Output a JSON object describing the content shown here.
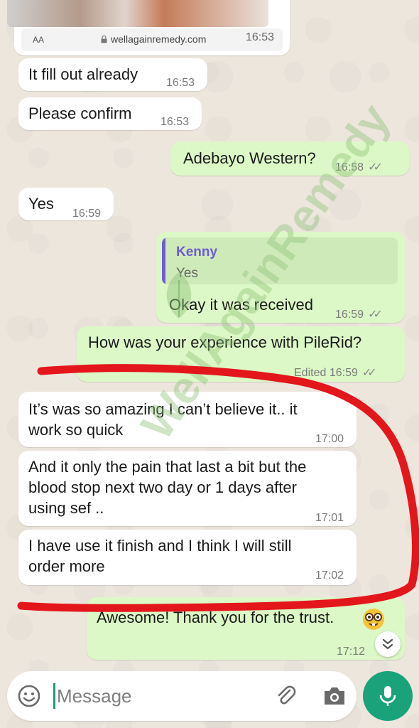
{
  "link_preview": {
    "aa_label": "AA",
    "url": "wellagainremedy.com",
    "time": "16:53"
  },
  "messages": [
    {
      "direction": "incoming",
      "text": "It fill out already",
      "time": "16:53"
    },
    {
      "direction": "incoming",
      "text": "Please confirm",
      "time": "16:53"
    },
    {
      "direction": "outgoing",
      "text": "Adebayo Western?",
      "time": "16:58",
      "status": "read"
    },
    {
      "direction": "incoming",
      "text": "Yes",
      "time": "16:59"
    },
    {
      "direction": "outgoing",
      "reply_to": {
        "name": "Kenny",
        "text": "Yes"
      },
      "text": "Okay it was received",
      "time": "16:59",
      "status": "read"
    },
    {
      "direction": "outgoing",
      "text": "How was your experience with PileRid?",
      "edited_label": "Edited",
      "time": "16:59",
      "status": "read"
    },
    {
      "direction": "incoming",
      "lines": [
        "It’s was so amazing I can’t believe it.. it",
        "work so quick"
      ],
      "time": "17:00"
    },
    {
      "direction": "incoming",
      "lines": [
        "And it only the pain that last a bit but the",
        "blood stop next two day or 1 days after",
        "using sef .."
      ],
      "time": "17:01"
    },
    {
      "direction": "incoming",
      "lines": [
        "I have use it finish and I think I will still",
        "order more"
      ],
      "time": "17:02"
    },
    {
      "direction": "outgoing",
      "text": "Awesome! Thank you for the trust.",
      "emoji": "nerd-face",
      "time": "17:12"
    }
  ],
  "watermark": "WellAgainRemedy",
  "composer": {
    "placeholder": "Message",
    "icons": [
      "emoji-icon",
      "paperclip-icon",
      "camera-icon",
      "microphone-icon",
      "chevron-down-icon"
    ]
  },
  "colors": {
    "wallpaper": "#ede6dd",
    "incoming_bubble": "#ffffff",
    "outgoing_bubble": "#dcf8c6",
    "reply_accent": "#6f5bd2",
    "mic_button": "#1aa37a",
    "annotation_red": "#e3161b",
    "watermark": "#8fc27a"
  }
}
